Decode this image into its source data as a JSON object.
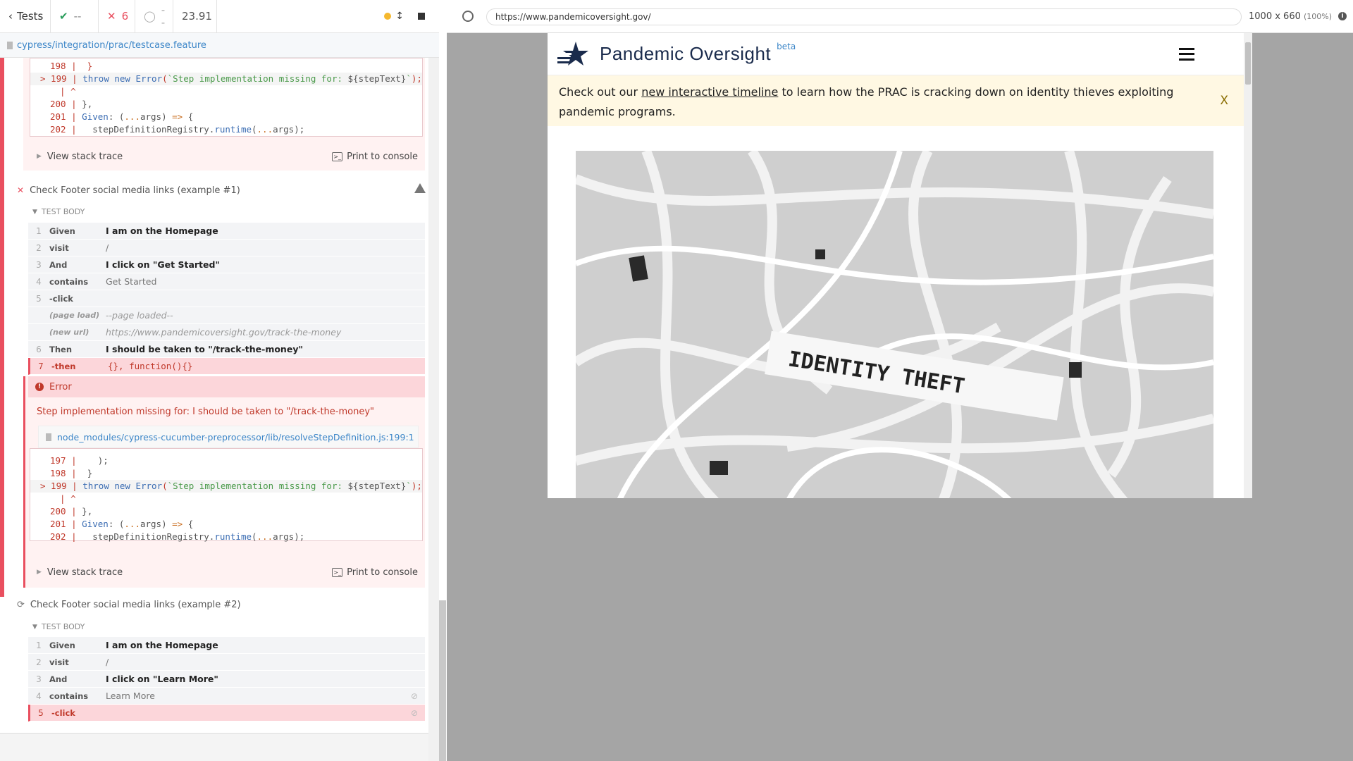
{
  "reporter": {
    "tests_label": "Tests",
    "passed": "--",
    "failed": "6",
    "pending": "--",
    "duration": "23.91",
    "spec_path": "cypress/integration/prac/testcase.feature"
  },
  "top_error": {
    "code_lines": [
      {
        "num": "198 |",
        "text": "  }"
      },
      {
        "num": "> 199 |",
        "text": "  throw new Error(`Step implementation missing for: ${stepText}`);"
      },
      {
        "num": "|",
        "text": "^"
      },
      {
        "num": "200 |",
        "text": "},"
      },
      {
        "num": "201 |",
        "text": "Given: (...args) => {"
      },
      {
        "num": "202 |",
        "text": "  stepDefinitionRegistry.runtime(...args);"
      }
    ],
    "view_stack": "View stack trace",
    "print": "Print to console"
  },
  "test1": {
    "title": "Check Footer social media links (example #1)",
    "body_label": "TEST BODY",
    "commands": [
      {
        "n": "1",
        "name": "Given",
        "msg": "I am on the Homepage"
      },
      {
        "n": "2",
        "name": "visit",
        "msg": "/"
      },
      {
        "n": "3",
        "name": "And",
        "msg": "I click on \"Get Started\""
      },
      {
        "n": "4",
        "name": "contains",
        "msg": "Get Started"
      },
      {
        "n": "5",
        "name": "-click",
        "msg": ""
      },
      {
        "n": "",
        "name": "(page load)",
        "msg": "--page loaded--"
      },
      {
        "n": "",
        "name": "(new url)",
        "msg": "https://www.pandemicoversight.gov/track-the-money"
      },
      {
        "n": "6",
        "name": "Then",
        "msg": "I should be taken to \"/track-the-money\""
      },
      {
        "n": "7",
        "name": "-then",
        "msg": "{}, function(){}"
      }
    ],
    "error_title": "Error",
    "error_message": "Step implementation missing for: I should be taken to \"/track-the-money\"",
    "file": "node_modules/cypress-cucumber-preprocessor/lib/resolveStepDefinition.js:199:1",
    "code_lines": [
      {
        "num": "197 |",
        "text": "    );"
      },
      {
        "num": "198 |",
        "text": "  }"
      },
      {
        "num": "> 199 |",
        "text": "  throw new Error(`Step implementation missing for: ${stepText}`);"
      },
      {
        "num": "|",
        "text": "^"
      },
      {
        "num": "200 |",
        "text": "},"
      },
      {
        "num": "201 |",
        "text": "Given: (...args) => {"
      },
      {
        "num": "202 |",
        "text": "  stepDefinitionRegistry.runtime(...args);"
      }
    ],
    "view_stack": "View stack trace",
    "print": "Print to console"
  },
  "test2": {
    "title": "Check Footer social media links (example #2)",
    "body_label": "TEST BODY",
    "commands": [
      {
        "n": "1",
        "name": "Given",
        "msg": "I am on the Homepage"
      },
      {
        "n": "2",
        "name": "visit",
        "msg": "/"
      },
      {
        "n": "3",
        "name": "And",
        "msg": "I click on \"Learn More\""
      },
      {
        "n": "4",
        "name": "contains",
        "msg": "Learn More"
      },
      {
        "n": "5",
        "name": "-click",
        "msg": ""
      }
    ]
  },
  "browser": {
    "url": "https://www.pandemicoversight.gov/",
    "viewport_size": "1000 x 660",
    "zoom": "(100%)"
  },
  "site": {
    "title_light": "Pandemic",
    "title_bold": "Oversight",
    "beta": "beta",
    "banner_pre": "Check out our",
    "banner_link": "new interactive timeline",
    "banner_post": "to learn how the PRAC is cracking down on identity thieves exploiting pandemic programs.",
    "banner_close": "X",
    "hero_text": "IDENTITY THEFT"
  },
  "colors": {
    "fail": "#e94f5f",
    "pass": "#2a9d5c",
    "link": "#3c86c8",
    "banner_bg": "#fff8e3",
    "brand_navy": "#1a2b4c"
  }
}
